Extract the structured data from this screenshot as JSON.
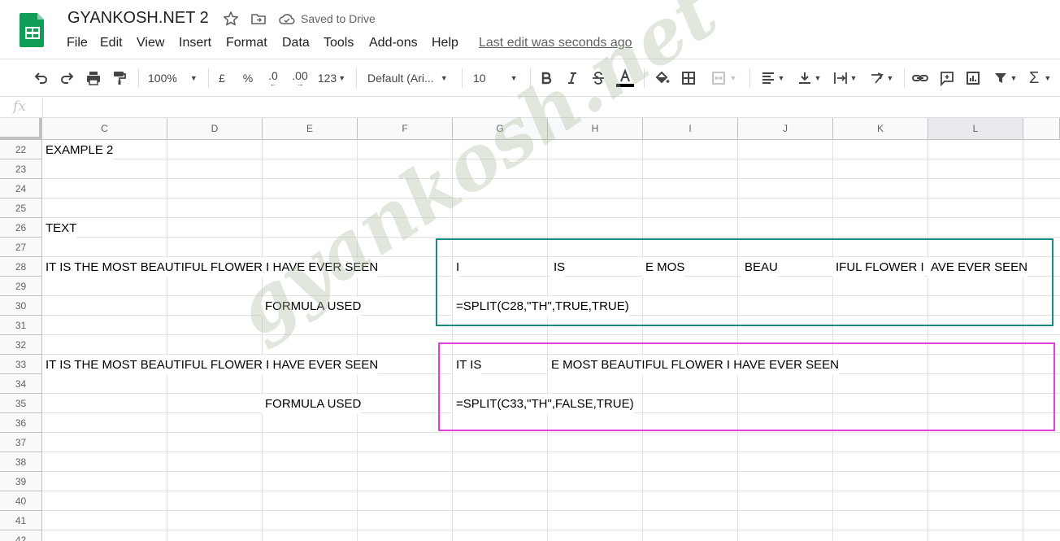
{
  "doc": {
    "title": "GYANKOSH.NET 2",
    "saved_status": "Saved to Drive",
    "last_edit": "Last edit was seconds ago"
  },
  "menu": [
    "File",
    "Edit",
    "View",
    "Insert",
    "Format",
    "Data",
    "Tools",
    "Add-ons",
    "Help"
  ],
  "toolbar": {
    "zoom": "100%",
    "currency": "£",
    "percent": "%",
    "decimal_decrease": ".0",
    "decimal_increase": ".00",
    "number_format": "123",
    "font": "Default (Ari...",
    "font_size": "10"
  },
  "formula_bar": {
    "fx": "fx",
    "value": ""
  },
  "columns": [
    "C",
    "D",
    "E",
    "F",
    "G",
    "H",
    "I",
    "J",
    "K",
    "L"
  ],
  "selected_column": "L",
  "rows": [
    "22",
    "23",
    "24",
    "25",
    "26",
    "27",
    "28",
    "29",
    "30",
    "31",
    "32",
    "33",
    "34",
    "35",
    "36",
    "37",
    "38",
    "39",
    "40",
    "41",
    "42"
  ],
  "cells": {
    "c22": "EXAMPLE 2",
    "c26": "TEXT",
    "c28": "IT IS THE MOST BEAUTIFUL FLOWER I HAVE EVER SEEN",
    "g28": "I",
    "h28": "IS",
    "i28": "E MOS",
    "j28": "BEAU",
    "k28": "IFUL FLOWER I",
    "l28": "AVE EVER SEEN",
    "e30": "FORMULA USED",
    "g30": "=SPLIT(C28,\"TH\",TRUE,TRUE)",
    "c33": "IT IS THE MOST BEAUTIFUL FLOWER I HAVE EVER SEEN",
    "g33": "IT IS",
    "h33": "E MOST BEAUTIFUL FLOWER I HAVE EVER SEEN",
    "e35": "FORMULA USED",
    "g35": "=SPLIT(C33,\"TH\",FALSE,TRUE)"
  },
  "watermark": "gyankosh.net",
  "colors": {
    "box1": "#1a8a86",
    "box2": "#e23fd8",
    "sheets_green": "#0f9d58"
  }
}
